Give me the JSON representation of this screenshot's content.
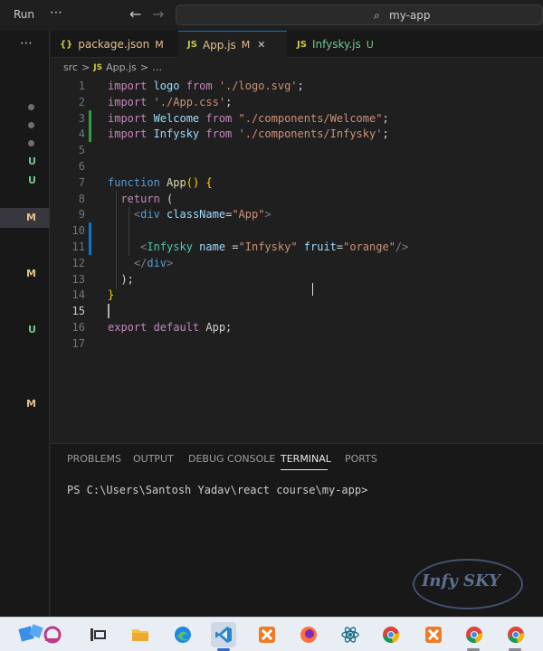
{
  "titlebar": {
    "run_label": "Run",
    "more": "⋯",
    "back": "←",
    "forward": "→",
    "search_icon": "⌕",
    "search_text": "my-app"
  },
  "activity": {
    "more": "⋯",
    "markers": [
      "U",
      "U",
      "M",
      "M",
      "U",
      "M"
    ]
  },
  "tabs": [
    {
      "icon": "{}",
      "label": "package.json",
      "status": "M"
    },
    {
      "icon": "JS",
      "label": "App.js",
      "status": "M",
      "close": "✕"
    },
    {
      "icon": "JS",
      "label": "Infysky.js",
      "status": "U"
    }
  ],
  "breadcrumb": {
    "folder": "src",
    "sep": ">",
    "file_icon": "JS",
    "file": "App.js",
    "more": "…"
  },
  "editor": {
    "lines": [
      {
        "n": "1",
        "t": [
          [
            "k1",
            "import "
          ],
          [
            "id",
            "logo "
          ],
          [
            "k1",
            "from "
          ],
          [
            "str",
            "'./logo.svg'"
          ],
          [
            "plain",
            ";"
          ]
        ]
      },
      {
        "n": "2",
        "t": [
          [
            "k1",
            "import "
          ],
          [
            "str",
            "'./App.css'"
          ],
          [
            "plain",
            ";"
          ]
        ]
      },
      {
        "n": "3",
        "t": [
          [
            "k1",
            "import "
          ],
          [
            "id",
            "Welcome "
          ],
          [
            "k1",
            "from "
          ],
          [
            "str",
            "\"./components/Welcome\""
          ],
          [
            "plain",
            ";"
          ]
        ]
      },
      {
        "n": "4",
        "t": [
          [
            "k1",
            "import "
          ],
          [
            "id",
            "Infysky "
          ],
          [
            "k1",
            "from "
          ],
          [
            "str",
            "'./components/Infysky'"
          ],
          [
            "plain",
            ";"
          ]
        ]
      },
      {
        "n": "5",
        "t": []
      },
      {
        "n": "6",
        "t": []
      },
      {
        "n": "7",
        "t": [
          [
            "k2",
            "function "
          ],
          [
            "fn",
            "App"
          ],
          [
            "br",
            "() {"
          ]
        ]
      },
      {
        "n": "8",
        "t": [
          [
            "plain",
            "  "
          ],
          [
            "k1",
            "return "
          ],
          [
            "plain",
            "("
          ]
        ]
      },
      {
        "n": "9",
        "t": [
          [
            "plain",
            "    "
          ],
          [
            "pun",
            "<"
          ],
          [
            "k2",
            "div "
          ],
          [
            "id",
            "className"
          ],
          [
            "plain",
            "="
          ],
          [
            "str",
            "\"App\""
          ],
          [
            "pun",
            ">"
          ]
        ]
      },
      {
        "n": "10",
        "t": []
      },
      {
        "n": "11",
        "t": [
          [
            "plain",
            "     "
          ],
          [
            "pun",
            "<"
          ],
          [
            "tag",
            "Infysky "
          ],
          [
            "id",
            "name "
          ],
          [
            "plain",
            "="
          ],
          [
            "str",
            "\"Infysky\" "
          ],
          [
            "id",
            "fruit"
          ],
          [
            "plain",
            "="
          ],
          [
            "str",
            "\"orange\""
          ],
          [
            "pun",
            "/>"
          ]
        ]
      },
      {
        "n": "12",
        "t": [
          [
            "plain",
            "    "
          ],
          [
            "pun",
            "</"
          ],
          [
            "k2",
            "div"
          ],
          [
            "pun",
            ">"
          ]
        ]
      },
      {
        "n": "13",
        "t": [
          [
            "plain",
            "  );"
          ]
        ]
      },
      {
        "n": "14",
        "t": [
          [
            "br",
            "}"
          ]
        ]
      },
      {
        "n": "15",
        "t": []
      },
      {
        "n": "16",
        "t": [
          [
            "k1",
            "export "
          ],
          [
            "k1",
            "default "
          ],
          [
            "plain",
            "App;"
          ]
        ]
      },
      {
        "n": "17",
        "t": []
      }
    ]
  },
  "panel": {
    "tabs": [
      "PROBLEMS",
      "OUTPUT",
      "DEBUG CONSOLE",
      "TERMINAL",
      "PORTS"
    ],
    "active_tab": "TERMINAL",
    "prompt": "PS C:\\Users\\Santosh Yadav\\react course\\my-app>"
  },
  "watermark": "Infy SKY",
  "taskbar": {
    "icons": [
      "start-icon",
      "task-view-icon",
      "file-explorer-icon",
      "edge-icon",
      "vscode-icon",
      "xampp-icon",
      "firefox-icon",
      "react-devtools-icon",
      "chrome-icon",
      "xampp-icon-2",
      "chrome-icon-2",
      "chrome-icon-3"
    ]
  },
  "colors": {
    "accent": "#0078d4",
    "modified": "#e2c08d",
    "untracked": "#73c991"
  }
}
